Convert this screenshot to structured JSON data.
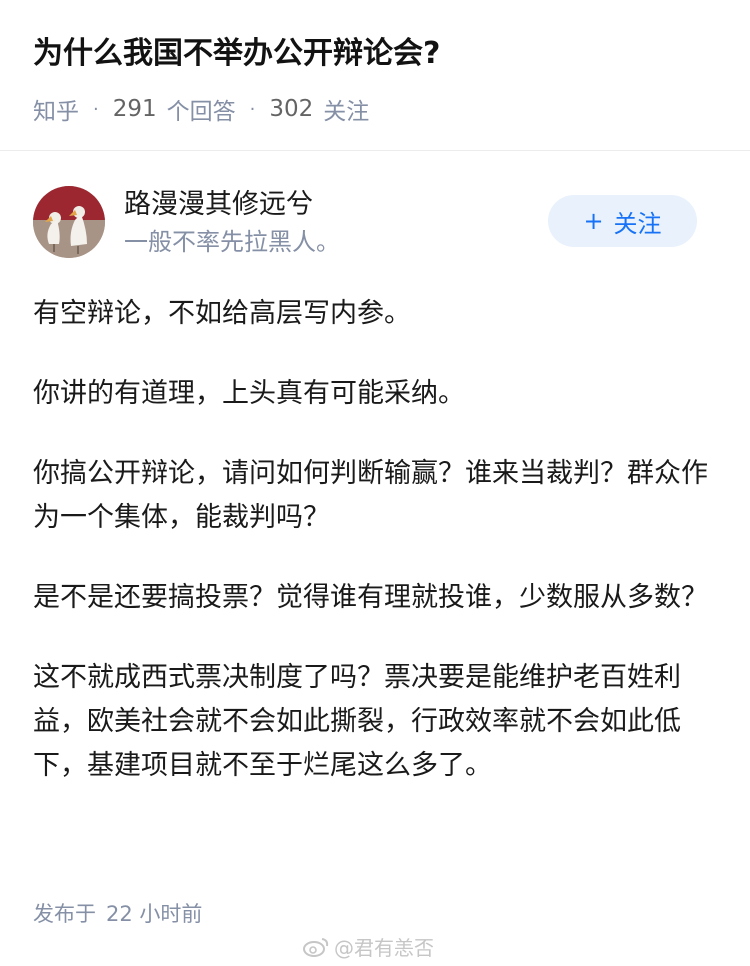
{
  "question": {
    "title": "为什么我国不举办公开辩论会?",
    "source": "知乎",
    "answers_count": "291",
    "answers_label": "个回答",
    "followers_count": "302",
    "followers_label": "关注"
  },
  "author": {
    "name": "路漫漫其修远兮",
    "bio": "一般不率先拉黑人。",
    "follow_label": "关注",
    "follow_icon": "plus-icon"
  },
  "answer": {
    "paragraphs": [
      "有空辩论，不如给高层写内参。",
      "你讲的有道理，上头真有可能采纳。",
      "你搞公开辩论，请问如何判断输赢？谁来当裁判？群众作为一个集体，能裁判吗？",
      "是不是还要搞投票？觉得谁有理就投谁，少数服从多数？",
      "这不就成西式票决制度了吗？票决要是能维护老百姓利益，欧美社会就不会如此撕裂，行政效率就不会如此低下，基建项目就不至于烂尾这么多了。"
    ],
    "published_label": "发布于",
    "published_time": "22 小时前"
  },
  "watermark": {
    "text": "@君有恙否",
    "icon": "weibo-icon"
  },
  "colors": {
    "accent": "#1772f6",
    "accent_bg": "#e8f1fc",
    "meta_gray": "#8590a6",
    "title": "#121212"
  }
}
